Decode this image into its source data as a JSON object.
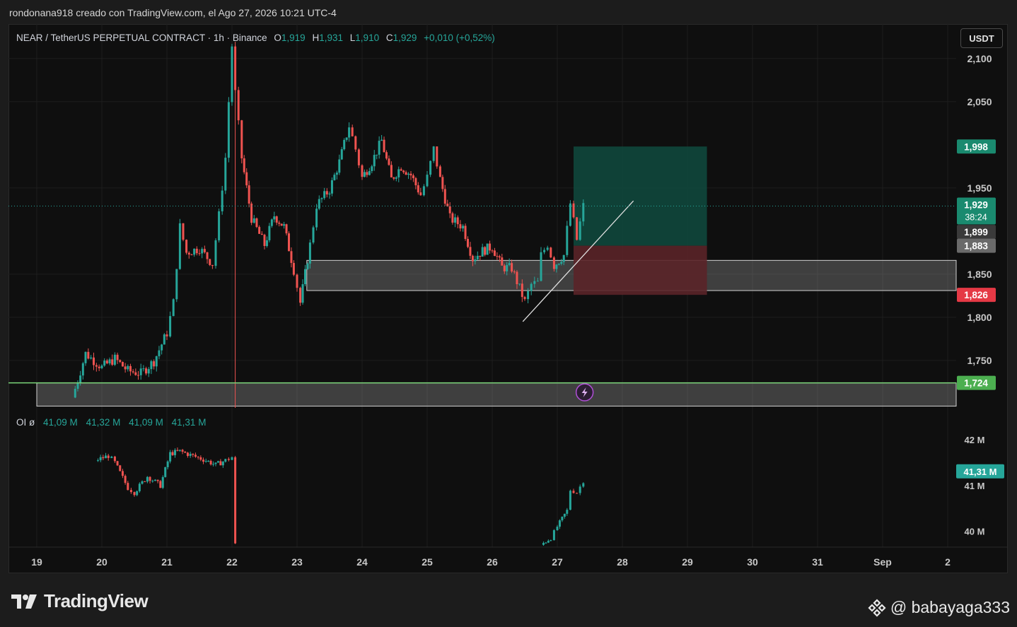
{
  "header": {
    "caption": "rondonana918 creado con TradingView.com, el Ago 27, 2026 10:21 UTC-4"
  },
  "legend": {
    "symbol": "NEAR / TetherUS PERPETUAL CONTRACT · 1h · Binance",
    "open_label": "O",
    "open": "1,919",
    "high_label": "H",
    "high": "1,931",
    "low_label": "L",
    "low": "1,910",
    "close_label": "C",
    "close": "1,929",
    "change": "+0,010 (+0,52%)"
  },
  "currency_button": "USDT",
  "oi_legend": {
    "label": "OI ø",
    "values": [
      "41,09 M",
      "41,32 M",
      "41,09 M",
      "41,31 M"
    ]
  },
  "footer": {
    "brand": "TradingView",
    "user": "@ babayaga333"
  },
  "colors": {
    "up": "#26a69a",
    "down": "#ef5350",
    "background": "#0f0f0f",
    "target_zone": "#0f4a3e",
    "stop_zone": "#5a2328",
    "support_line": "#7bd67a",
    "grid": "#1e1e1e",
    "axis_text": "#c8c8c8"
  },
  "chart_data": {
    "type": "candlestick",
    "price_axis": {
      "ticks": [
        "2,100",
        "2,050",
        "1,950",
        "1,850",
        "1,800",
        "1,750"
      ],
      "tick_values": [
        2.1,
        2.05,
        1.95,
        1.85,
        1.8,
        1.75
      ],
      "range": [
        1.695,
        2.14
      ]
    },
    "time_axis": {
      "ticks": [
        "19",
        "20",
        "21",
        "22",
        "23",
        "24",
        "25",
        "26",
        "27",
        "28",
        "29",
        "30",
        "31",
        "Sep",
        "2"
      ]
    },
    "price_labels": [
      {
        "text": "1,998",
        "value": 1.998,
        "bg": "#1a8a6f",
        "fg": "#ffffff"
      },
      {
        "text": "1,929",
        "value": 1.929,
        "bg": "#1a8a6f",
        "fg": "#ffffff",
        "sub": "38:24"
      },
      {
        "text": "1,899",
        "value": 1.899,
        "bg": "#3a3a3a",
        "fg": "#ffffff"
      },
      {
        "text": "1,883",
        "value": 1.883,
        "bg": "#6a6a6a",
        "fg": "#ffffff"
      },
      {
        "text": "1,826",
        "value": 1.826,
        "bg": "#e53945",
        "fg": "#ffffff"
      },
      {
        "text": "1,724",
        "value": 1.724,
        "bg": "#4caf50",
        "fg": "#ffffff"
      }
    ],
    "support_line": 1.724,
    "current_price": 1.929,
    "zones": [
      {
        "name": "demand zone",
        "from_day": 23.15,
        "to_day": 33.6,
        "low": 1.831,
        "high": 1.866
      },
      {
        "name": "support zone",
        "from_day": 19.0,
        "to_day": 33.6,
        "low": 1.697,
        "high": 1.724
      }
    ],
    "long_position": {
      "from_day": 27.25,
      "to_day": 29.3,
      "entry": 1.883,
      "target": 1.998,
      "stop": 1.826
    },
    "trendline": {
      "start": [
        26.47,
        1.795
      ],
      "end": [
        28.17,
        1.935
      ]
    },
    "oi_axis": {
      "ticks": [
        "42 M",
        "41 M",
        "40 M"
      ],
      "tick_values": [
        42,
        41,
        40
      ],
      "range": [
        39.65,
        42.7
      ],
      "current": "41,31 M"
    },
    "price_path": [
      [
        19.55,
        1.707
      ],
      [
        19.75,
        1.758
      ],
      [
        20.0,
        1.742
      ],
      [
        20.2,
        1.752
      ],
      [
        20.4,
        1.738
      ],
      [
        20.6,
        1.735
      ],
      [
        20.8,
        1.749
      ],
      [
        21.0,
        1.782
      ],
      [
        21.1,
        1.817
      ],
      [
        21.2,
        1.905
      ],
      [
        21.3,
        1.875
      ],
      [
        21.5,
        1.88
      ],
      [
        21.7,
        1.862
      ],
      [
        21.8,
        1.918
      ],
      [
        21.9,
        1.985
      ],
      [
        22.0,
        2.115
      ],
      [
        22.05,
        2.06
      ],
      [
        22.15,
        1.985
      ],
      [
        22.3,
        1.915
      ],
      [
        22.5,
        1.884
      ],
      [
        22.65,
        1.918
      ],
      [
        22.8,
        1.905
      ],
      [
        22.95,
        1.855
      ],
      [
        23.05,
        1.817
      ],
      [
        23.2,
        1.884
      ],
      [
        23.3,
        1.93
      ],
      [
        23.5,
        1.948
      ],
      [
        23.65,
        1.98
      ],
      [
        23.8,
        2.022
      ],
      [
        23.9,
        1.995
      ],
      [
        24.0,
        1.962
      ],
      [
        24.15,
        1.98
      ],
      [
        24.3,
        2.005
      ],
      [
        24.45,
        1.96
      ],
      [
        24.6,
        1.975
      ],
      [
        24.75,
        1.965
      ],
      [
        24.9,
        1.942
      ],
      [
        25.0,
        1.962
      ],
      [
        25.1,
        1.995
      ],
      [
        25.2,
        1.96
      ],
      [
        25.35,
        1.915
      ],
      [
        25.55,
        1.905
      ],
      [
        25.7,
        1.868
      ],
      [
        25.85,
        1.877
      ],
      [
        26.0,
        1.882
      ],
      [
        26.15,
        1.858
      ],
      [
        26.3,
        1.857
      ],
      [
        26.5,
        1.818
      ],
      [
        26.6,
        1.838
      ],
      [
        26.7,
        1.84
      ],
      [
        26.75,
        1.872
      ],
      [
        26.85,
        1.885
      ],
      [
        26.95,
        1.86
      ],
      [
        27.1,
        1.872
      ],
      [
        27.2,
        1.932
      ],
      [
        27.3,
        1.89
      ],
      [
        27.4,
        1.929
      ]
    ],
    "oi_path": [
      [
        19.9,
        41.55
      ],
      [
        20.1,
        41.65
      ],
      [
        20.2,
        41.5
      ],
      [
        20.4,
        40.95
      ],
      [
        20.5,
        40.85
      ],
      [
        20.7,
        41.2
      ],
      [
        20.9,
        41.0
      ],
      [
        21.05,
        41.7
      ],
      [
        21.2,
        41.75
      ],
      [
        21.4,
        41.65
      ],
      [
        21.6,
        41.55
      ],
      [
        21.75,
        41.45
      ],
      [
        21.9,
        41.55
      ],
      [
        22.0,
        41.62
      ],
      [
        22.05,
        39.7
      ]
    ],
    "oi_path_late": [
      [
        26.75,
        39.7
      ],
      [
        26.9,
        39.85
      ],
      [
        27.0,
        40.1
      ],
      [
        27.15,
        40.45
      ],
      [
        27.2,
        40.9
      ],
      [
        27.3,
        40.85
      ],
      [
        27.4,
        41.1
      ]
    ]
  }
}
